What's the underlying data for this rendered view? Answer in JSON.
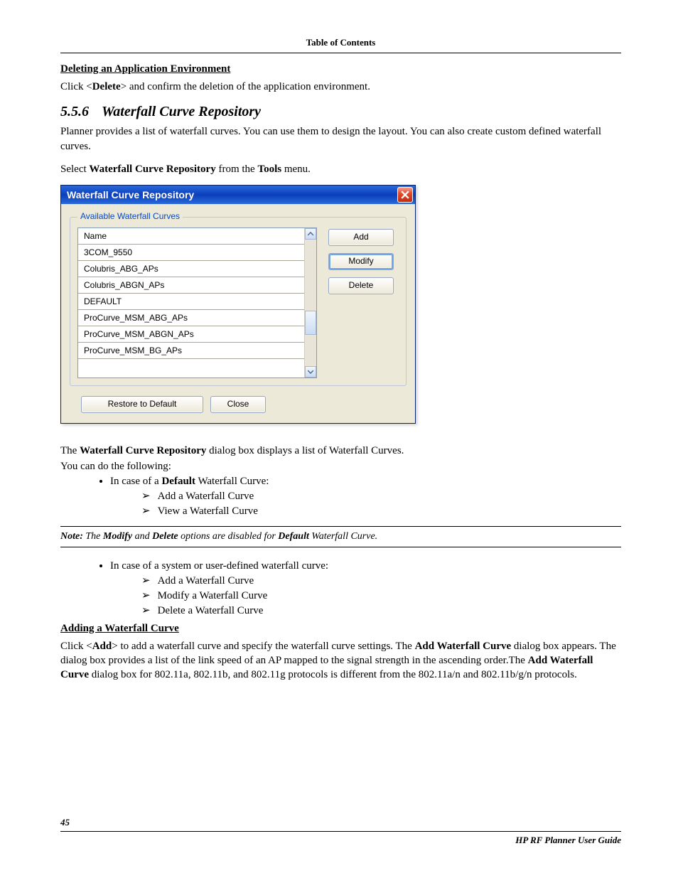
{
  "toc_header": "Table of Contents",
  "sec_delete": {
    "heading": "Deleting an Application Environment",
    "body_prefix": "Click <",
    "body_bold": "Delete",
    "body_suffix": "> and confirm the deletion of the application environment."
  },
  "sec_waterfall": {
    "number": "5.5.6",
    "title": "Waterfall Curve Repository",
    "para1": "Planner provides a list of waterfall curves. You can use them to design the layout. You can also create custom defined waterfall curves.",
    "para2_a": "Select ",
    "para2_b": "Waterfall Curve Repository",
    "para2_c": " from the ",
    "para2_d": "Tools",
    "para2_e": " menu."
  },
  "dialog": {
    "title": "Waterfall Curve Repository",
    "group_legend": "Available Waterfall Curves",
    "list_header": "Name",
    "rows": [
      "3COM_9550",
      "Colubris_ABG_APs",
      "Colubris_ABGN_APs",
      "DEFAULT",
      "ProCurve_MSM_ABG_APs",
      "ProCurve_MSM_ABGN_APs",
      "ProCurve_MSM_BG_APs"
    ],
    "btn_add": "Add",
    "btn_modify": "Modify",
    "btn_delete": "Delete",
    "btn_restore": "Restore to Default",
    "btn_close": "Close"
  },
  "after_dialog": {
    "line1_a": "The ",
    "line1_b": "Waterfall Curve Repository",
    "line1_c": " dialog box displays a list of Waterfall Curves.",
    "line2": "You can do the following:",
    "b1_a": "In case of a ",
    "b1_b": "Default",
    "b1_c": " Waterfall Curve:",
    "b1_s1": "Add a Waterfall Curve",
    "b1_s2": "View a Waterfall Curve"
  },
  "note": {
    "prefix": "Note:",
    "a": " The ",
    "b": "Modify",
    "c": " and ",
    "d": "Delete",
    "e": " options are disabled for ",
    "f": "Default",
    "g": " Waterfall Curve."
  },
  "after_note": {
    "b2": "In case of a system or user-defined waterfall curve:",
    "b2_s1": "Add a Waterfall Curve",
    "b2_s2": "Modify a Waterfall Curve",
    "b2_s3": "Delete a Waterfall Curve"
  },
  "sec_adding": {
    "heading": "Adding a Waterfall Curve",
    "p_a": "Click <",
    "p_b": "Add",
    "p_c": "> to add a waterfall curve and specify the waterfall curve settings. The ",
    "p_d": "Add Waterfall Curve",
    "p_e": " dialog box appears. The dialog box provides a list of the link speed of an AP mapped to the signal strength in the ascending order.The ",
    "p_f": "Add Waterfall Curve",
    "p_g": " dialog box for 802.11a, 802.11b, and 802.11g protocols is different from the 802.11a/n and 802.11b/g/n protocols."
  },
  "page_number": "45",
  "footer": "HP RF Planner User Guide"
}
